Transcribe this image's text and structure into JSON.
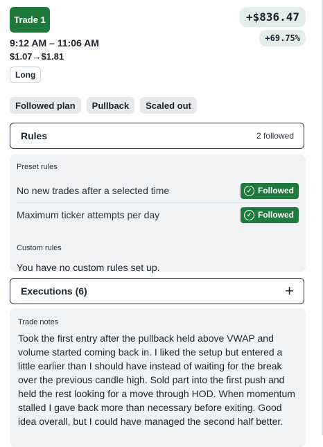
{
  "trade": {
    "badge": "Trade 1",
    "pnl": "+$836.47",
    "pnl_pct": "+69.75%",
    "time_range": "9:12 AM – 11:06 AM",
    "entry_price": "$1.07",
    "arrow": "→",
    "exit_price": "$1.81",
    "side": "Long"
  },
  "tags": [
    "Followed plan",
    "Pullback",
    "Scaled out"
  ],
  "rules": {
    "title": "Rules",
    "count": "2 followed",
    "preset_label": "Preset rules",
    "preset": [
      {
        "text": "No new trades after a selected time",
        "status": "Followed"
      },
      {
        "text": "Maximum ticker attempts per day",
        "status": "Followed"
      }
    ],
    "custom_label": "Custom rules",
    "custom_empty": "You have no custom rules set up."
  },
  "executions": {
    "title": "Executions (6)",
    "expand_icon": "plus-icon"
  },
  "notes": {
    "label": "Trade notes",
    "text": "Took the first entry after the pullback held above VWAP and volume started coming back in. I liked the setup but entered a little earlier than I should have instead of waiting for the break over the previous candle high. Sold part into the first push and held the rest looking for a move through HOD. When momentum stalled I gave back more than necessary before exiting. Good idea overall, but I could have managed the second half better."
  },
  "colors": {
    "accent_green": "#1d7a3c",
    "pnl_bg": "#e4eee8",
    "panel_bg": "#f1f2f4"
  }
}
